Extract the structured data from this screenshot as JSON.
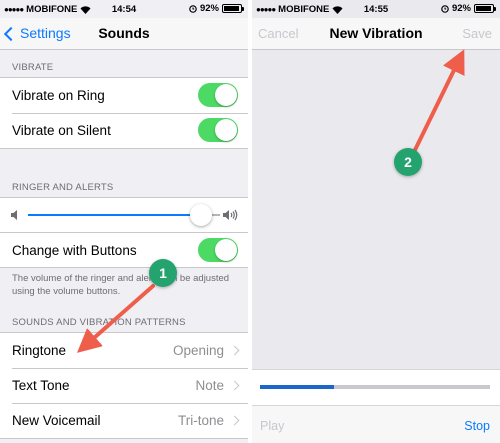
{
  "left_screen": {
    "status_bar": {
      "carrier": "MOBIFONE",
      "time": "14:54",
      "battery": "92%",
      "signal_dots": "●●●●●"
    },
    "nav": {
      "back_label": "Settings",
      "title": "Sounds"
    },
    "vibrate": {
      "header": "VIBRATE",
      "rows": [
        {
          "label": "Vibrate on Ring",
          "on": true
        },
        {
          "label": "Vibrate on Silent",
          "on": true
        }
      ]
    },
    "ringer": {
      "header": "RINGER AND ALERTS",
      "volume_level": 0.9,
      "change_with_buttons_label": "Change with Buttons",
      "change_with_buttons_on": true,
      "footer": "The volume of the ringer and alerts can be adjusted using the volume buttons."
    },
    "patterns": {
      "header": "SOUNDS AND VIBRATION PATTERNS",
      "rows": [
        {
          "label": "Ringtone",
          "value": "Opening"
        },
        {
          "label": "Text Tone",
          "value": "Note"
        },
        {
          "label": "New Voicemail",
          "value": "Tri-tone"
        }
      ]
    }
  },
  "right_screen": {
    "status_bar": {
      "carrier": "MOBIFONE",
      "time": "14:55",
      "battery": "92%",
      "signal_dots": "●●●●●"
    },
    "nav": {
      "cancel_label": "Cancel",
      "title": "New Vibration",
      "save_label": "Save"
    },
    "progress": 0.32,
    "bottom": {
      "play_label": "Play",
      "stop_label": "Stop"
    }
  },
  "annotations": {
    "callout_1": "1",
    "callout_2": "2",
    "arrow_color": "#ef5e4a",
    "callout_color": "#24a36f"
  }
}
